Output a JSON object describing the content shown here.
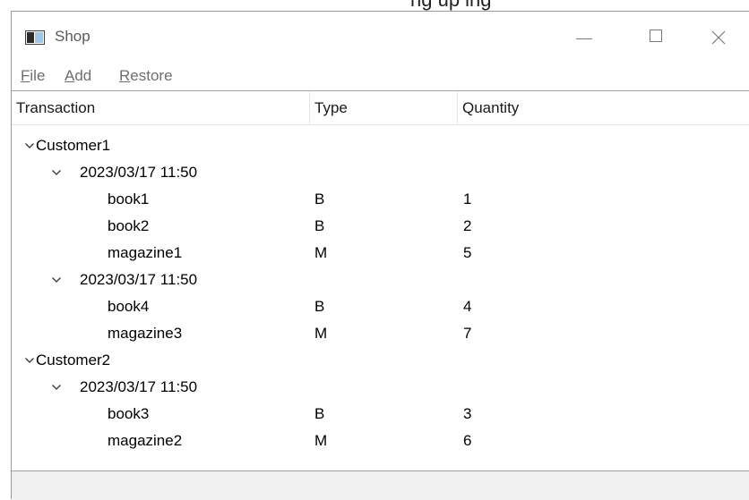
{
  "window": {
    "above_text": "ng up ing",
    "title": "Shop"
  },
  "menu": {
    "file": {
      "mnemonic": "F",
      "rest": "ile"
    },
    "add": {
      "mnemonic": "A",
      "rest": "dd"
    },
    "restore": {
      "mnemonic": "R",
      "rest": "estore"
    }
  },
  "tree": {
    "columns": [
      "Transaction",
      "Type",
      "Quantity"
    ],
    "rows": [
      {
        "level": 0,
        "expandable": true,
        "label": "Customer1",
        "type": "",
        "quantity": ""
      },
      {
        "level": 1,
        "expandable": true,
        "label": "2023/03/17 11:50",
        "type": "",
        "quantity": ""
      },
      {
        "level": 2,
        "expandable": false,
        "label": "book1",
        "type": "B",
        "quantity": "1"
      },
      {
        "level": 2,
        "expandable": false,
        "label": "book2",
        "type": "B",
        "quantity": "2"
      },
      {
        "level": 2,
        "expandable": false,
        "label": "magazine1",
        "type": "M",
        "quantity": "5"
      },
      {
        "level": 1,
        "expandable": true,
        "label": "2023/03/17 11:50",
        "type": "",
        "quantity": ""
      },
      {
        "level": 2,
        "expandable": false,
        "label": "book4",
        "type": "B",
        "quantity": "4"
      },
      {
        "level": 2,
        "expandable": false,
        "label": "magazine3",
        "type": "M",
        "quantity": "7"
      },
      {
        "level": 0,
        "expandable": true,
        "label": "Customer2",
        "type": "",
        "quantity": ""
      },
      {
        "level": 1,
        "expandable": true,
        "label": "2023/03/17 11:50",
        "type": "",
        "quantity": ""
      },
      {
        "level": 2,
        "expandable": false,
        "label": "book3",
        "type": "B",
        "quantity": "3"
      },
      {
        "level": 2,
        "expandable": false,
        "label": "magazine2",
        "type": "M",
        "quantity": "6"
      }
    ]
  },
  "colors": {
    "menu_text": "#6e6e6e",
    "title_text": "#5a5a5a",
    "frame": "#9a9a9a"
  }
}
